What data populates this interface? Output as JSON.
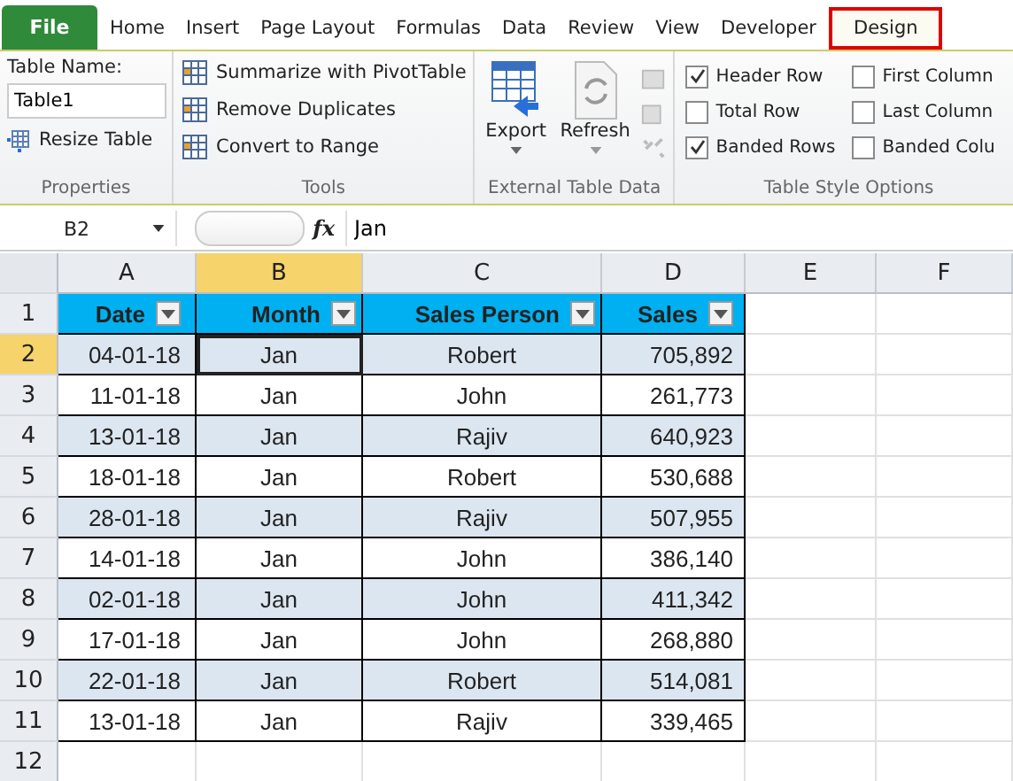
{
  "tabs": [
    {
      "label": "File",
      "kind": "file",
      "selected": false
    },
    {
      "label": "Home",
      "kind": "tab",
      "selected": false
    },
    {
      "label": "Insert",
      "kind": "tab",
      "selected": false
    },
    {
      "label": "Page Layout",
      "kind": "tab",
      "selected": false
    },
    {
      "label": "Formulas",
      "kind": "tab",
      "selected": false
    },
    {
      "label": "Data",
      "kind": "tab",
      "selected": false
    },
    {
      "label": "Review",
      "kind": "tab",
      "selected": false
    },
    {
      "label": "View",
      "kind": "tab",
      "selected": false
    },
    {
      "label": "Developer",
      "kind": "tab",
      "selected": false
    },
    {
      "label": "Design",
      "kind": "tab",
      "selected": true
    }
  ],
  "ribbon": {
    "properties": {
      "name_label": "Table Name:",
      "name_value": "Table1",
      "resize": "Resize Table",
      "group": "Properties"
    },
    "tools": {
      "items": [
        "Summarize with PivotTable",
        "Remove Duplicates",
        "Convert to Range"
      ],
      "group": "Tools"
    },
    "external": {
      "export": "Export",
      "refresh": "Refresh",
      "group": "External Table Data"
    },
    "style_options": {
      "group": "Table Style Options",
      "options": [
        {
          "label": "Header Row",
          "checked": true
        },
        {
          "label": "Total Row",
          "checked": false
        },
        {
          "label": "Banded Rows",
          "checked": true
        },
        {
          "label": "First Column",
          "checked": false
        },
        {
          "label": "Last Column",
          "checked": false
        },
        {
          "label": "Banded Colu",
          "checked": false
        }
      ]
    }
  },
  "formula_bar": {
    "name_box": "B2",
    "fx": "fx",
    "value": "Jan"
  },
  "sheet": {
    "columns": [
      {
        "letter": "A",
        "selected": false
      },
      {
        "letter": "B",
        "selected": true
      },
      {
        "letter": "C",
        "selected": false
      },
      {
        "letter": "D",
        "selected": false
      },
      {
        "letter": "E",
        "selected": false
      },
      {
        "letter": "F",
        "selected": false
      }
    ],
    "rows": [
      {
        "number": "1",
        "kind": "header",
        "selected": false,
        "cells": [
          {
            "text": "Date",
            "selected": false
          },
          {
            "text": "Month",
            "selected": false
          },
          {
            "text": "Sales Person",
            "selected": false
          },
          {
            "text": "Sales",
            "selected": false
          }
        ]
      },
      {
        "number": "2",
        "kind": "data",
        "selected": true,
        "cells": [
          {
            "text": "04-01-18",
            "selected": false
          },
          {
            "text": "Jan",
            "selected": true
          },
          {
            "text": "Robert",
            "selected": false
          },
          {
            "text": "705,892",
            "selected": false
          }
        ]
      },
      {
        "number": "3",
        "kind": "data",
        "selected": false,
        "cells": [
          {
            "text": "11-01-18",
            "selected": false
          },
          {
            "text": "Jan",
            "selected": false
          },
          {
            "text": "John",
            "selected": false
          },
          {
            "text": "261,773",
            "selected": false
          }
        ]
      },
      {
        "number": "4",
        "kind": "data",
        "selected": false,
        "cells": [
          {
            "text": "13-01-18",
            "selected": false
          },
          {
            "text": "Jan",
            "selected": false
          },
          {
            "text": "Rajiv",
            "selected": false
          },
          {
            "text": "640,923",
            "selected": false
          }
        ]
      },
      {
        "number": "5",
        "kind": "data",
        "selected": false,
        "cells": [
          {
            "text": "18-01-18",
            "selected": false
          },
          {
            "text": "Jan",
            "selected": false
          },
          {
            "text": "Robert",
            "selected": false
          },
          {
            "text": "530,688",
            "selected": false
          }
        ]
      },
      {
        "number": "6",
        "kind": "data",
        "selected": false,
        "cells": [
          {
            "text": "28-01-18",
            "selected": false
          },
          {
            "text": "Jan",
            "selected": false
          },
          {
            "text": "Rajiv",
            "selected": false
          },
          {
            "text": "507,955",
            "selected": false
          }
        ]
      },
      {
        "number": "7",
        "kind": "data",
        "selected": false,
        "cells": [
          {
            "text": "14-01-18",
            "selected": false
          },
          {
            "text": "Jan",
            "selected": false
          },
          {
            "text": "John",
            "selected": false
          },
          {
            "text": "386,140",
            "selected": false
          }
        ]
      },
      {
        "number": "8",
        "kind": "data",
        "selected": false,
        "cells": [
          {
            "text": "02-01-18",
            "selected": false
          },
          {
            "text": "Jan",
            "selected": false
          },
          {
            "text": "John",
            "selected": false
          },
          {
            "text": "411,342",
            "selected": false
          }
        ]
      },
      {
        "number": "9",
        "kind": "data",
        "selected": false,
        "cells": [
          {
            "text": "17-01-18",
            "selected": false
          },
          {
            "text": "Jan",
            "selected": false
          },
          {
            "text": "John",
            "selected": false
          },
          {
            "text": "268,880",
            "selected": false
          }
        ]
      },
      {
        "number": "10",
        "kind": "data",
        "selected": false,
        "cells": [
          {
            "text": "22-01-18",
            "selected": false
          },
          {
            "text": "Jan",
            "selected": false
          },
          {
            "text": "Robert",
            "selected": false
          },
          {
            "text": "514,081",
            "selected": false
          }
        ]
      },
      {
        "number": "11",
        "kind": "data",
        "selected": false,
        "cells": [
          {
            "text": "13-01-18",
            "selected": false
          },
          {
            "text": "Jan",
            "selected": false
          },
          {
            "text": "Rajiv",
            "selected": false
          },
          {
            "text": "339,465",
            "selected": false
          }
        ]
      },
      {
        "number": "12",
        "kind": "empty",
        "selected": false,
        "cells": []
      }
    ]
  }
}
